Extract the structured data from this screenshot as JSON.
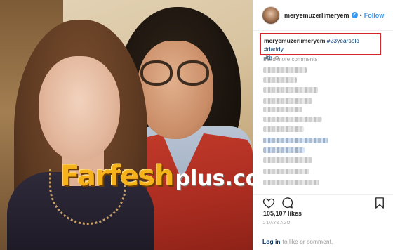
{
  "post": {
    "photo_watermark": {
      "main": "Farfesh",
      "sub": "plus.com"
    }
  },
  "header": {
    "username": "meryemuzerlimeryem",
    "verified_icon": "verified-badge-icon",
    "separator": "•",
    "follow_label": "Follow"
  },
  "caption": {
    "username": "meryemuzerlimeryem",
    "hashtags": [
      "#23yearsold",
      "#daddy",
      "#tb"
    ],
    "emoji": "☺",
    "highlight_color": "#d6262c"
  },
  "comments": {
    "load_more_label": "Load more comments",
    "blurred": true
  },
  "actions": {
    "icons": [
      "heart-icon",
      "comment-icon",
      "bookmark-icon"
    ]
  },
  "stats": {
    "likes": "105,107 likes",
    "posted": "2 DAYS AGO"
  },
  "footer": {
    "login_label": "Log in",
    "rest_text": "to like or comment."
  },
  "colors": {
    "accent": "#3897f0",
    "hashtag": "#003569"
  }
}
